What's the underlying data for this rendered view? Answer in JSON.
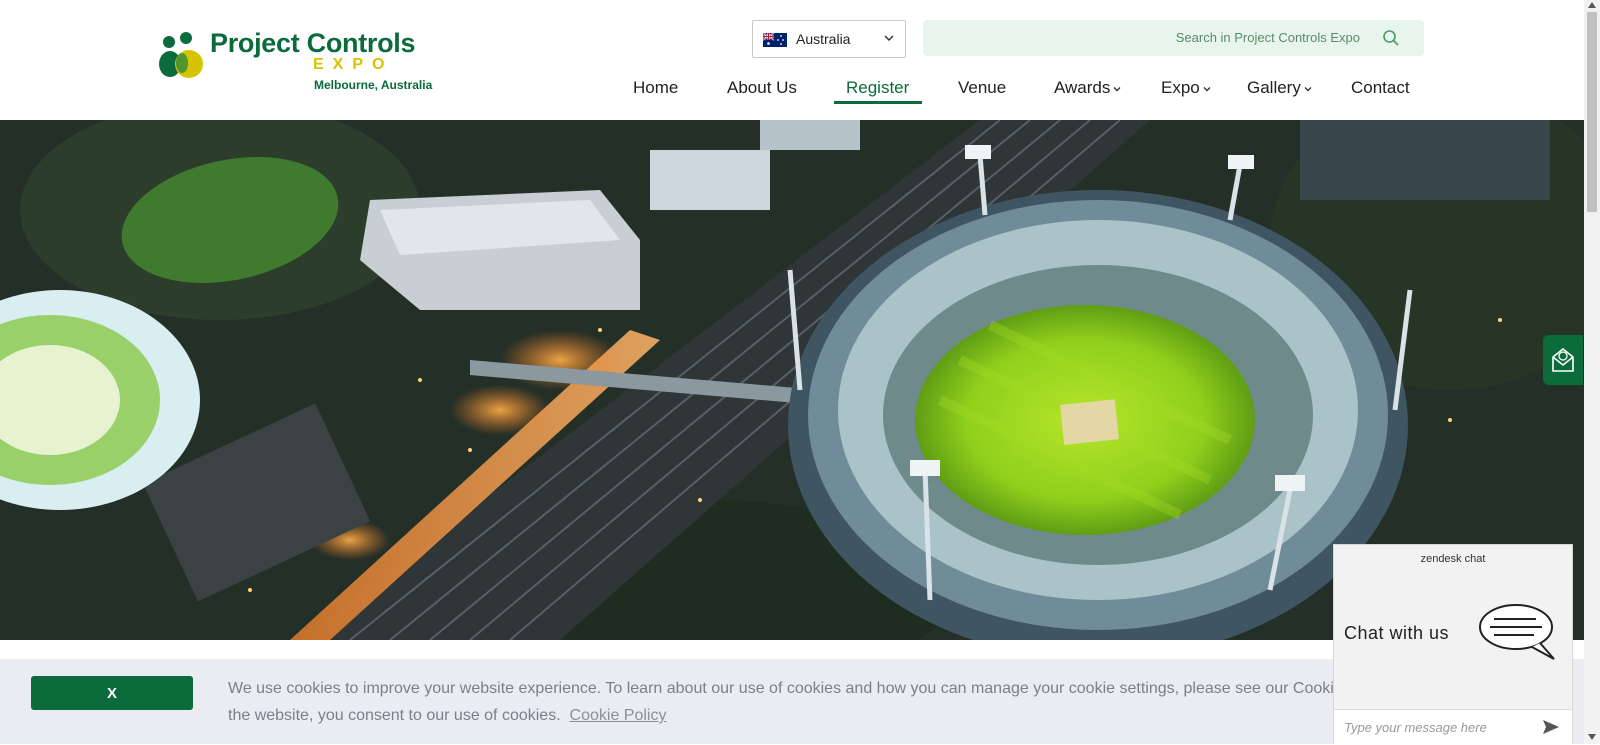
{
  "header": {
    "logo": {
      "title": "Project Controls",
      "sub": "EXPO",
      "location": "Melbourne, Australia"
    },
    "country_select": {
      "value": "Australia",
      "flag_icon": "australia-flag-icon"
    },
    "search": {
      "placeholder": "Search in Project Controls Expo",
      "icon": "search-icon"
    }
  },
  "nav": {
    "items": [
      {
        "label": "Home"
      },
      {
        "label": "About Us"
      },
      {
        "label": "Register",
        "active": true
      },
      {
        "label": "Venue"
      },
      {
        "label": "Awards",
        "dropdown": true
      },
      {
        "label": "Expo",
        "dropdown": true
      },
      {
        "label": "Gallery",
        "dropdown": true
      },
      {
        "label": "Contact"
      }
    ]
  },
  "hero": {
    "image": "aerial-stadium-photo"
  },
  "side_tab": {
    "icon": "email-icon"
  },
  "cookie_banner": {
    "close_label": "X",
    "text": "We use cookies to improve your website experience. To learn about our use of cookies and how you can manage your cookie settings, please see our Cooki",
    "text_line2": "the website, you consent to our use of cookies.",
    "link_label": "Cookie Policy"
  },
  "chat": {
    "brand": "zendesk chat",
    "label": "Chat with us",
    "input_placeholder": "Type your message here",
    "icon": "chat-bubble-icon",
    "send_icon": "send-icon"
  },
  "colors": {
    "brand_green": "#0b6b3a",
    "brand_yellow": "#d7c300",
    "search_bg": "#e8f5ec",
    "cookie_bg": "#eaecf2"
  }
}
